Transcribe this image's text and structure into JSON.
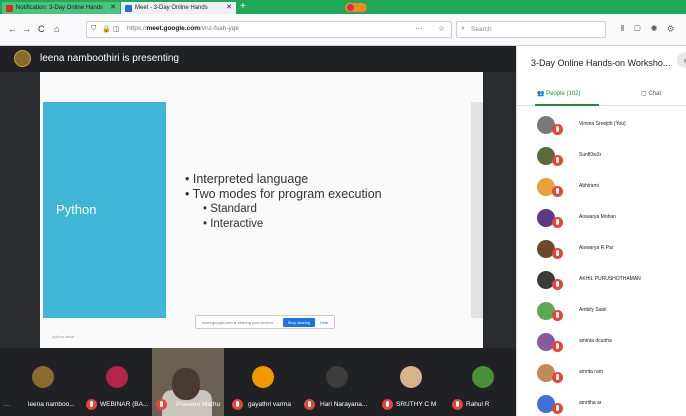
{
  "browser": {
    "tabs": [
      {
        "label": "Notification: 3-Day Online Hands",
        "icon": "gmail-icon",
        "color": "#d93025"
      },
      {
        "label": "Meet - 3-Day Online Hands",
        "icon": "meet-icon",
        "color": "#1a73e8"
      }
    ],
    "new_tab": "+",
    "nav": {
      "back": "←",
      "forward": "→",
      "reload": "C",
      "home": "⌂"
    },
    "url_prefix": "https://",
    "url_domain": "meet.google.com",
    "url_path": "/vnz-fsah-yqe",
    "url_more": "···",
    "search_placeholder": "Search",
    "toolbar_icons": "⫴ ▢ ◉ ⚙"
  },
  "meet": {
    "presenter_text": "leena namboothiri is presenting",
    "slide": {
      "title": "Python",
      "bullets": [
        "• Interpreted language",
        "• Two modes for program execution"
      ],
      "sub_bullets": [
        "• Standard",
        "• Interactive"
      ],
      "footer": "python-asun",
      "share_message": "meet.google.com is sharing your screen.",
      "stop_button": "Stop sharing",
      "hide_link": "Hide"
    },
    "filmstrip": [
      {
        "label": "leena namboo...",
        "color": "#8a6a2e"
      },
      {
        "label": "WEBINAR (BA...",
        "color": "#b3264b"
      },
      {
        "label": "Praveen Mathu",
        "color": "#6b6152"
      },
      {
        "label": "gayathri varma",
        "color": "#f29900"
      },
      {
        "label": "Hari Narayana...",
        "color": "#3c3c3c"
      },
      {
        "label": "SRUTHY C M",
        "color": "#d9b38c"
      },
      {
        "label": "Rahul R",
        "color": "#4a8f3a"
      }
    ],
    "more_icon": "···"
  },
  "panel": {
    "title": "3-Day Online Hands-on Worksho...",
    "close": "›",
    "tab_people": "People (102)",
    "tab_chat": "Chat",
    "participants": [
      {
        "name": "Vimina Sreejith (You)",
        "color": "#7a7a7a"
      },
      {
        "name": "Sunfl0w3r",
        "color": "#5a6b3a"
      },
      {
        "name": "Abhirami",
        "color": "#e6a23c"
      },
      {
        "name": "Aiswarya Mohan",
        "color": "#5b3a8a"
      },
      {
        "name": "Aiswarya R Par",
        "color": "#6b4a2b"
      },
      {
        "name": "AKHIL PURUSHOTHAMAN",
        "color": "#3a3a3a"
      },
      {
        "name": "Ambily Sanil",
        "color": "#5aaa55"
      },
      {
        "name": "aminta dcunha",
        "color": "#8a5aa0"
      },
      {
        "name": "amrita ram",
        "color": "#c08a5a"
      },
      {
        "name": "amritha ar",
        "color": "#3f6fd8"
      }
    ]
  }
}
